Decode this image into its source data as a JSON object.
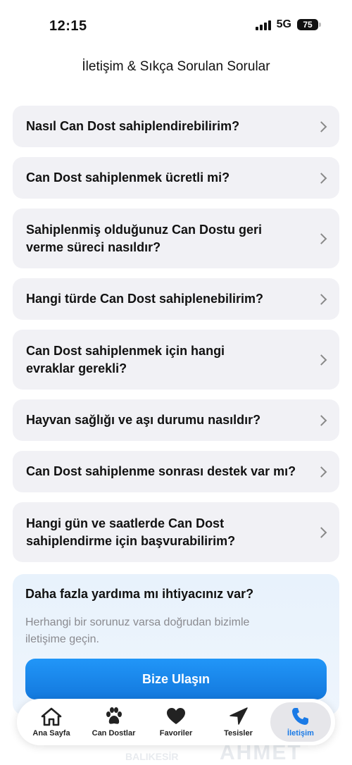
{
  "status_bar": {
    "time": "12:15",
    "network": "5G",
    "battery": "75"
  },
  "page": {
    "title": "İletişim & Sıkça Sorulan Sorular"
  },
  "faq": {
    "items": [
      {
        "question": "Nasıl Can Dost sahiplendirebilirim?"
      },
      {
        "question": "Can Dost sahiplenmek ücretli mi?"
      },
      {
        "question": "Sahiplenmiş olduğunuz Can Dostu geri verme süreci nasıldır?"
      },
      {
        "question": "Hangi türde Can Dost sahiplenebilirim?"
      },
      {
        "question": "Can Dost sahiplenmek için hangi evraklar gerekli?"
      },
      {
        "question": "Hayvan sağlığı ve aşı durumu nasıldır?"
      },
      {
        "question": "Can Dost sahiplenme sonrası destek var mı?"
      },
      {
        "question": "Hangi gün ve saatlerde Can Dost sahiplendirme için başvurabilirim?"
      }
    ]
  },
  "help_card": {
    "title": "Daha fazla yardıma mı ihtiyacınız var?",
    "text": "Herhangi bir sorunuz varsa doğrudan bizimle iletişime geçin.",
    "button_label": "Bize Ulaşın"
  },
  "watermark": {
    "text1": "BALIKESİR",
    "text2": "AHMET"
  },
  "tab_bar": {
    "items": [
      {
        "label": "Ana Sayfa",
        "icon": "home-icon"
      },
      {
        "label": "Can Dostlar",
        "icon": "paw-icon"
      },
      {
        "label": "Favoriler",
        "icon": "heart-icon"
      },
      {
        "label": "Tesisler",
        "icon": "navigation-arrow-icon"
      },
      {
        "label": "İletişim",
        "icon": "phone-icon"
      }
    ],
    "active_index": 4
  },
  "colors": {
    "accent": "#1a7ae6",
    "button": "#1e88f0",
    "card_bg": "#f1f1f5",
    "help_bg": "#e8f2fc"
  }
}
